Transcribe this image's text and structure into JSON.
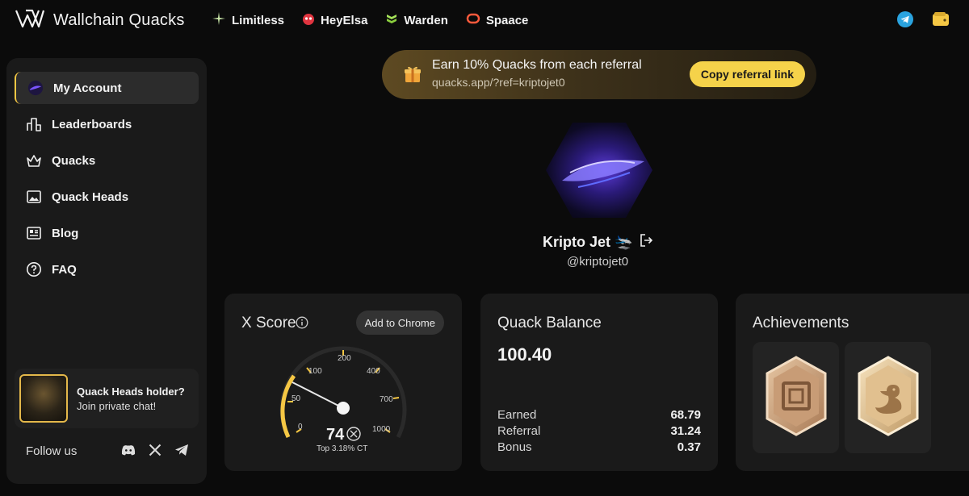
{
  "brand": {
    "name": "Wallchain Quacks",
    "icon": "wallchain-logo-icon"
  },
  "partners": [
    {
      "label": "Limitless",
      "icon": "limitless-icon"
    },
    {
      "label": "HeyElsa",
      "icon": "heyelsa-icon"
    },
    {
      "label": "Warden",
      "icon": "warden-icon"
    },
    {
      "label": "Spaace",
      "icon": "spaace-icon"
    }
  ],
  "sidebar": {
    "items": [
      {
        "label": "My Account",
        "icon": "account-avatar-icon",
        "active": true
      },
      {
        "label": "Leaderboards",
        "icon": "leaderboard-icon"
      },
      {
        "label": "Quacks",
        "icon": "crown-basket-icon"
      },
      {
        "label": "Quack Heads",
        "icon": "image-icon"
      },
      {
        "label": "Blog",
        "icon": "newspaper-icon"
      },
      {
        "label": "FAQ",
        "icon": "question-icon"
      }
    ],
    "holder": {
      "title": "Quack Heads holder?",
      "subtitle": "Join private chat!"
    },
    "follow_label": "Follow us"
  },
  "referral": {
    "title": "Earn 10% Quacks from each referral",
    "link": "quacks.app/?ref=kriptojet0",
    "button": "Copy referral link"
  },
  "profile": {
    "name": "Kripto Jet 🛬",
    "handle": "@kriptojet0"
  },
  "xscore": {
    "title": "X Score",
    "button": "Add to Chrome",
    "value": "74",
    "rank": "Top 3.18% CT",
    "ticks": [
      "0",
      "50",
      "100",
      "200",
      "400",
      "700",
      "1000"
    ]
  },
  "balance": {
    "title": "Quack Balance",
    "value": "100.40",
    "rows": [
      {
        "label": "Earned",
        "value": "68.79"
      },
      {
        "label": "Referral",
        "value": "31.24"
      },
      {
        "label": "Bonus",
        "value": "0.37"
      }
    ]
  },
  "achievements": {
    "title": "Achievements"
  },
  "colors": {
    "accent": "#f5c744",
    "card": "#1a1a1a",
    "background": "#0b0b0b"
  }
}
